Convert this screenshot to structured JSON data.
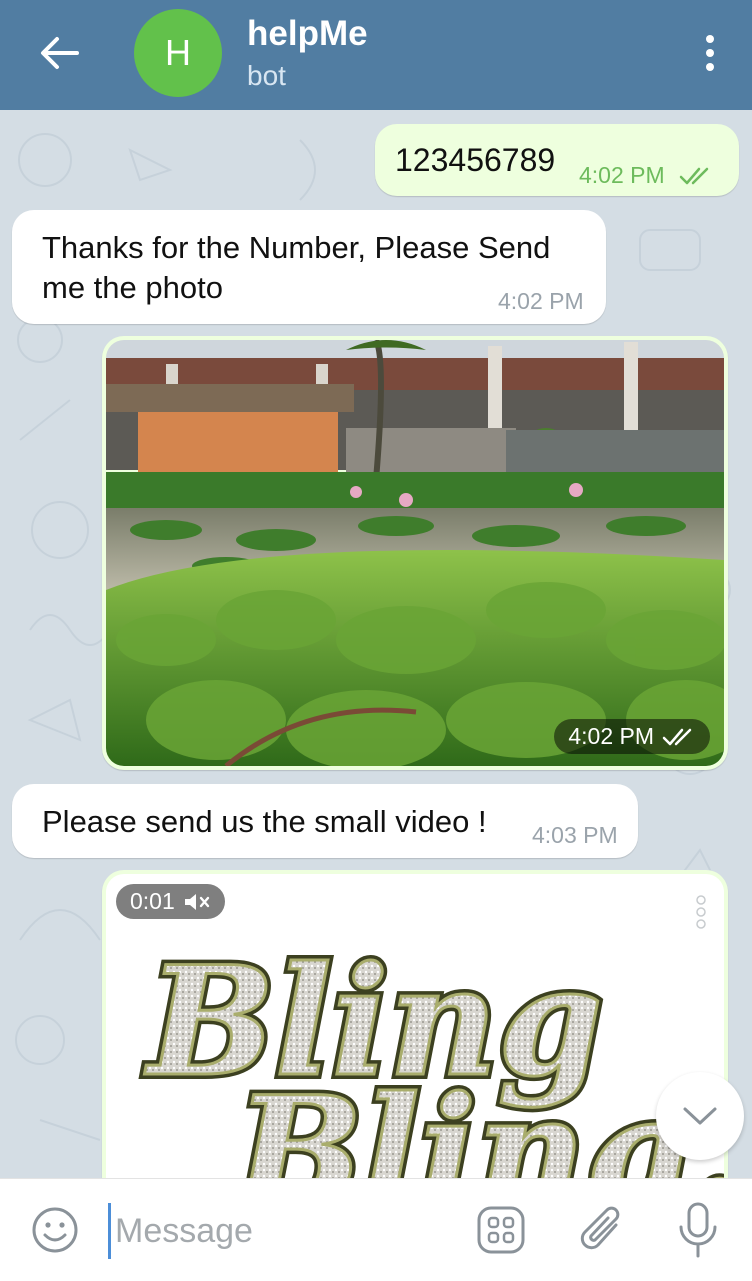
{
  "header": {
    "title": "helpMe",
    "subtitle": "bot",
    "avatar_letter": "H",
    "avatar_color": "#62c14b",
    "bar_color": "#517da2"
  },
  "messages": [
    {
      "type": "text",
      "direction": "outgoing",
      "text": "123456789",
      "time": "4:02 PM",
      "status": "read"
    },
    {
      "type": "text",
      "direction": "incoming",
      "text_line1": "Thanks for the Number, Please Send",
      "text_line2": "me the photo",
      "time": "4:02 PM"
    },
    {
      "type": "photo",
      "direction": "outgoing",
      "time": "4:02 PM",
      "status": "read"
    },
    {
      "type": "text",
      "direction": "incoming",
      "text": "Please send us the small video !",
      "time": "4:03 PM"
    },
    {
      "type": "video",
      "direction": "outgoing",
      "duration": "0:01",
      "muted": true,
      "caption_art": "Bling Bling"
    }
  ],
  "input": {
    "placeholder": "Message"
  },
  "colors": {
    "outgoing_bubble": "#eeffde",
    "incoming_bubble": "#ffffff",
    "read_check": "#6dbb5c"
  }
}
